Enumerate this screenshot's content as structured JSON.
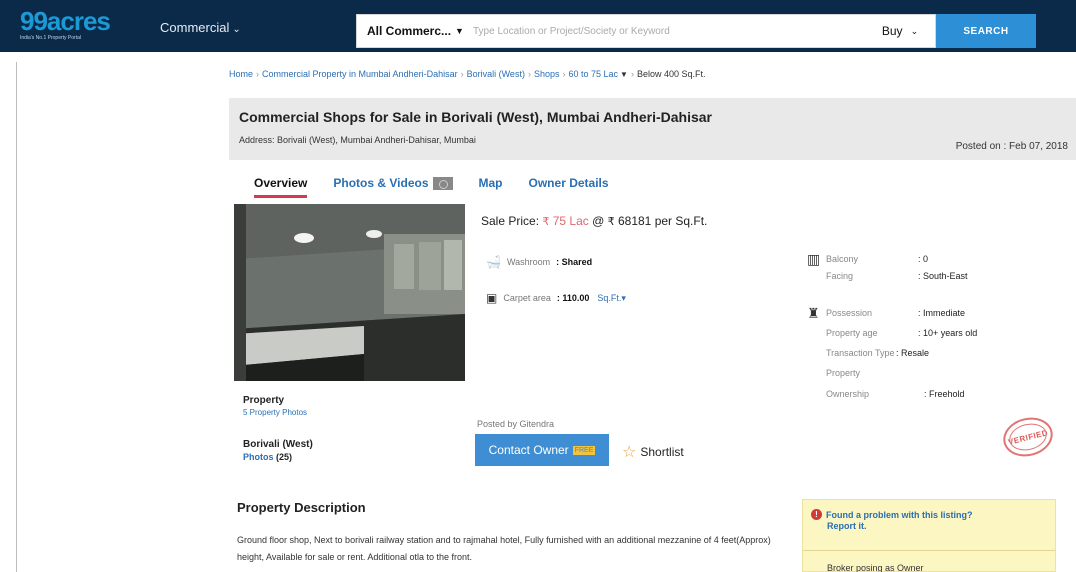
{
  "header": {
    "logo": "99acres",
    "logo_sub": "India's No.1 Property Portal",
    "nav_commercial": "Commercial",
    "search": {
      "category": "All Commerc...",
      "placeholder": "Type Location or Project/Society or Keyword",
      "mode": "Buy",
      "button": "SEARCH"
    }
  },
  "breadcrumb": {
    "items": [
      "Home",
      "Commercial Property in Mumbai Andheri-Dahisar",
      "Borivali (West)",
      "Shops",
      "60 to 75 Lac"
    ],
    "current": "Below 400 Sq.Ft."
  },
  "listing": {
    "title": "Commercial Shops for Sale in Borivali (West), Mumbai Andheri-Dahisar",
    "address": "Address: Borivali (West), Mumbai Andheri-Dahisar, Mumbai",
    "posted_on": "Posted on : Feb 07, 2018"
  },
  "tabs": [
    "Overview",
    "Photos & Videos",
    "Map",
    "Owner Details"
  ],
  "photo_caption": {
    "title": "Property",
    "link": "5 Property Photos",
    "locality": "Borivali (West)",
    "photos_label": "Photos",
    "photos_count": "(25)"
  },
  "price": {
    "label": "Sale Price:",
    "amount": "75 Lac",
    "at": "@",
    "per_sqft": "68181",
    "per_unit": "per Sq.Ft."
  },
  "details_left": [
    {
      "label": "Washroom",
      "value": ": Shared"
    },
    {
      "label": "Carpet area",
      "value": ": 110.00",
      "unit": "Sq.Ft.▾"
    }
  ],
  "details_right": [
    {
      "label": "Balcony",
      "value": ": 0"
    },
    {
      "label": "Facing",
      "value": ": South-East"
    },
    {
      "label": "Possession",
      "value": ": Immediate"
    },
    {
      "label": "Property age",
      "value": ": 10+ years old"
    },
    {
      "label": "Transaction Type",
      "value": ": Resale"
    },
    {
      "label": "Property",
      "value": ""
    },
    {
      "label": "Ownership",
      "value": ": Freehold"
    }
  ],
  "posted_by": "Posted by Gitendra",
  "contact_button": "Contact Owner",
  "contact_free": "FREE",
  "shortlist": "Shortlist",
  "stamp": "VERIFIED",
  "description": {
    "title": "Property Description",
    "text": "Ground floor shop, Next to borivali railway station and to rajmahal hotel, Fully furnished with an additional mezzanine of 4 feet(Approx) height, Available for sale or rent. Additional otla to the front."
  },
  "problem_box": {
    "line1": "Found a problem with this listing?",
    "line2": "Report it.",
    "bottom": "Broker posing as Owner"
  }
}
